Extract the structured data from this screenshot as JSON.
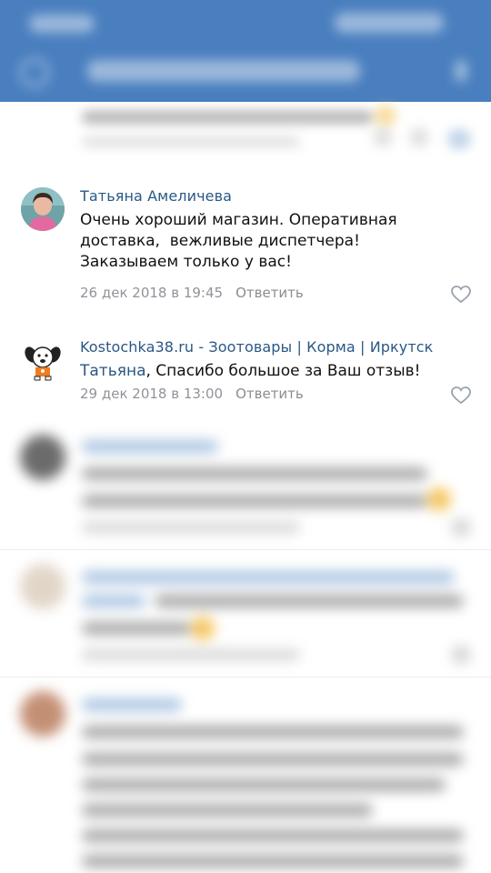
{
  "header": {
    "bg_color": "#4a7fbf"
  },
  "comments": [
    {
      "author": "Татьяна Амеличева",
      "text_lines": [
        "Очень хороший магазин. Оперативная",
        "доставка,  вежливые диспетчера!",
        "Заказываем только у вас!"
      ],
      "date": "26 дек 2018 в 19:45",
      "reply_label": "Ответить",
      "avatar_icon": "user-photo-icon",
      "like_icon": "heart-icon"
    },
    {
      "author": "Kostochka38.ru - Зоотовары | Корма | Иркутск",
      "mention": "Татьяна",
      "text": ", Спасибо большое за Ваш отзыв!",
      "date": "29 дек 2018 в 13:00",
      "reply_label": "Ответить",
      "avatar_icon": "dog-logo-icon",
      "like_icon": "heart-icon"
    }
  ],
  "colors": {
    "link": "#2a5885",
    "meta": "#909399",
    "text": "#111111"
  }
}
